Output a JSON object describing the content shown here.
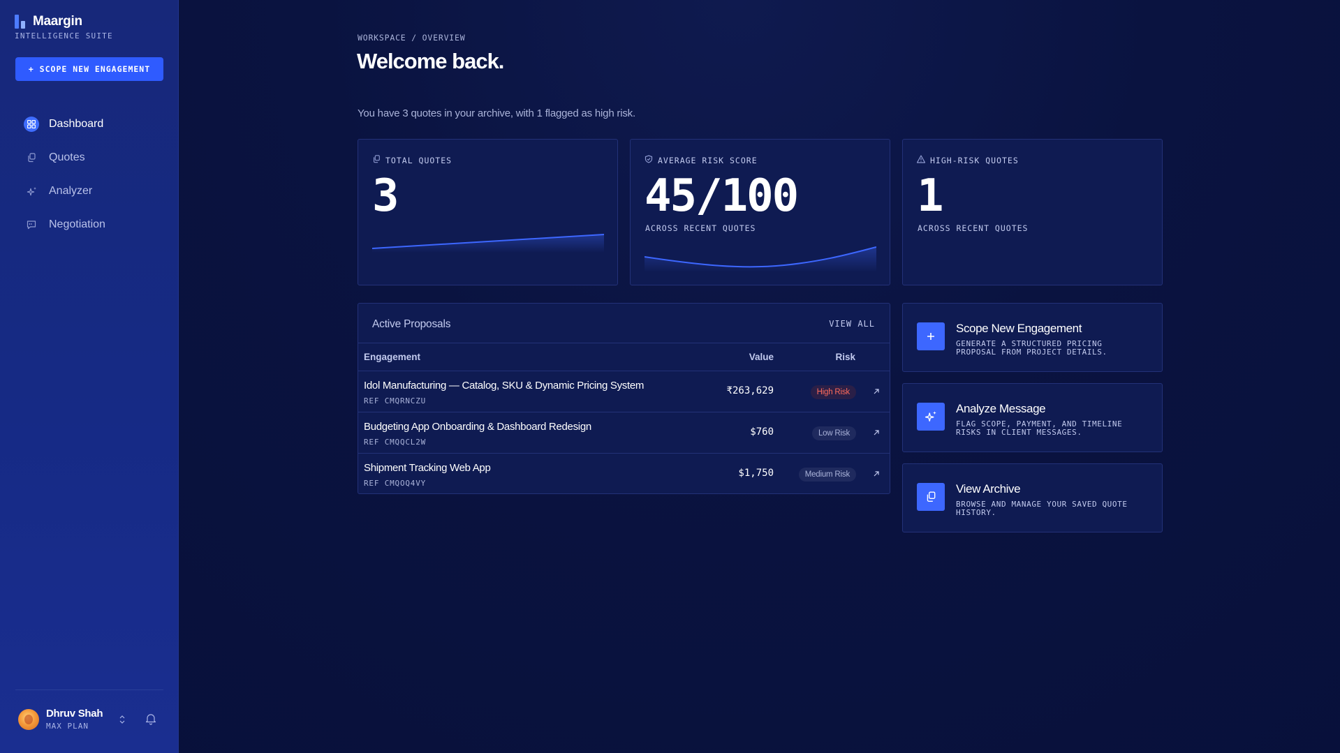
{
  "brand": {
    "name": "Maargin",
    "tagline": "INTELLIGENCE SUITE"
  },
  "sidebar": {
    "cta_label": "+ SCOPE NEW ENGAGEMENT",
    "nav": [
      {
        "label": "Dashboard",
        "icon": "grid-icon",
        "active": true
      },
      {
        "label": "Quotes",
        "icon": "documents-icon",
        "active": false
      },
      {
        "label": "Analyzer",
        "icon": "sparkle-icon",
        "active": false
      },
      {
        "label": "Negotiation",
        "icon": "chat-icon",
        "active": false
      }
    ],
    "user": {
      "name": "Dhruv Shah",
      "plan": "MAX PLAN"
    }
  },
  "header": {
    "breadcrumb": "WORKSPACE / OVERVIEW",
    "title": "Welcome back.",
    "subtitle": "You have 3 quotes in your archive, with 1 flagged as high risk."
  },
  "stats": [
    {
      "label": "TOTAL QUOTES",
      "value": "3",
      "note": "",
      "icon": "documents-icon"
    },
    {
      "label": "AVERAGE RISK SCORE",
      "value": "45/100",
      "note": "ACROSS RECENT QUOTES",
      "icon": "shield-icon"
    },
    {
      "label": "HIGH-RISK QUOTES",
      "value": "1",
      "note": "ACROSS RECENT QUOTES",
      "icon": "warning-icon"
    }
  ],
  "proposals": {
    "title": "Active Proposals",
    "view_all": "VIEW ALL",
    "columns": [
      "Engagement",
      "Value",
      "Risk"
    ],
    "rows": [
      {
        "title": "Idol Manufacturing — Catalog, SKU & Dynamic Pricing System",
        "ref": "REF CMQRNCZU",
        "value": "₹263,629",
        "risk": "High Risk"
      },
      {
        "title": "Budgeting App Onboarding & Dashboard Redesign",
        "ref": "REF CMQQCL2W",
        "value": "$760",
        "risk": "Low Risk"
      },
      {
        "title": "Shipment Tracking Web App",
        "ref": "REF CMQOQ4VY",
        "value": "$1,750",
        "risk": "Medium Risk"
      }
    ]
  },
  "actions": [
    {
      "title": "Scope New Engagement",
      "desc": "GENERATE A STRUCTURED PRICING PROPOSAL FROM PROJECT DETAILS.",
      "icon": "plus-icon"
    },
    {
      "title": "Analyze Message",
      "desc": "FLAG SCOPE, PAYMENT, AND TIMELINE RISKS IN CLIENT MESSAGES.",
      "icon": "sparkle-icon"
    },
    {
      "title": "View Archive",
      "desc": "BROWSE AND MANAGE YOUR SAVED QUOTE HISTORY.",
      "icon": "documents-icon"
    }
  ],
  "colors": {
    "accent": "#2f5bff",
    "high_risk": "#ff6b5c",
    "background": "#0a1340",
    "sidebar": "#162a85"
  }
}
